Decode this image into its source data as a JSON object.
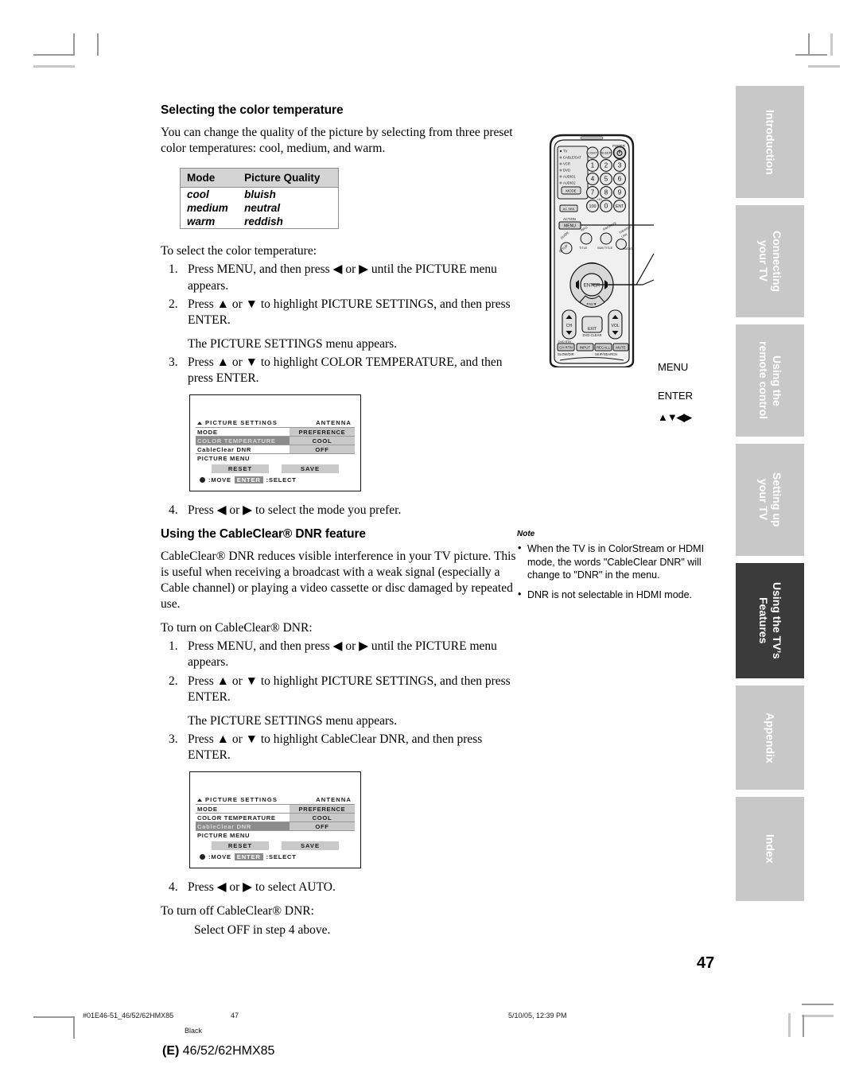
{
  "document": {
    "page_number": "47",
    "model_line_prefix": "(E)",
    "model_line": "46/52/62HMX85"
  },
  "section_color": {
    "tab_inactive": "#c8c8c8",
    "tab_active": "#3b3b3b",
    "table_header_bg": "#d4d4d4",
    "osd_highlight": "#8c8c8c",
    "osd_value_bg": "#c9c9c9"
  },
  "section1": {
    "title": "Selecting the color temperature",
    "intro": "You can change the quality of the picture by selecting from three preset color temperatures: cool, medium, and warm.",
    "table": {
      "headers": [
        "Mode",
        "Picture Quality"
      ],
      "rows": [
        [
          "cool",
          "bluish"
        ],
        [
          "medium",
          "neutral"
        ],
        [
          "warm",
          "reddish"
        ]
      ]
    },
    "lead_in": "To select the color temperature:",
    "steps": [
      {
        "num": "1.",
        "text": "Press MENU, and then press ◀ or ▶ until the PICTURE menu appears."
      },
      {
        "num": "2.",
        "text": "Press ▲ or ▼ to highlight PICTURE SETTINGS, and then press ENTER."
      },
      {
        "num": "3.",
        "text": "Press ▲ or ▼ to highlight COLOR TEMPERATURE, and then press ENTER."
      }
    ],
    "substep_after_2": "The PICTURE SETTINGS menu appears.",
    "step4": {
      "num": "4.",
      "text": "Press ◀ or ▶ to select the mode you prefer."
    }
  },
  "osd1": {
    "title": "PICTURE SETTINGS",
    "source": "ANTENNA",
    "rows": [
      {
        "label": "MODE",
        "value": "PREFERENCE",
        "selected": false
      },
      {
        "label": "COLOR TEMPERATURE",
        "value": "COOL",
        "selected": true
      },
      {
        "label": "CableClear DNR",
        "value": "OFF",
        "selected": false
      },
      {
        "label": "PICTURE MENU",
        "value": "",
        "selected": false
      }
    ],
    "buttons": [
      "RESET",
      "SAVE"
    ],
    "footer_move": ":MOVE",
    "footer_enter": "ENTER",
    "footer_select": ":SELECT"
  },
  "section2": {
    "title": "Using the CableClear® DNR feature",
    "intro": "CableClear® DNR reduces visible interference in your TV picture. This is useful when receiving a broadcast with a weak signal (especially a Cable channel) or playing a video cassette or disc damaged by repeated use.",
    "lead_in": "To turn on CableClear® DNR:",
    "steps": [
      {
        "num": "1.",
        "text": "Press MENU, and then press ◀ or ▶ until the PICTURE menu appears."
      },
      {
        "num": "2.",
        "text": "Press ▲ or ▼ to highlight PICTURE SETTINGS, and then press ENTER."
      },
      {
        "num": "3.",
        "text": "Press ▲ or ▼ to highlight CableClear DNR, and then press ENTER."
      }
    ],
    "substep_after_2": "The PICTURE SETTINGS menu appears.",
    "step4": {
      "num": "4.",
      "text": "Press ◀ or ▶ to select AUTO."
    },
    "turn_off_lead": "To turn off CableClear® DNR:",
    "turn_off_text": "Select OFF in step 4 above."
  },
  "osd2": {
    "title": "PICTURE SETTINGS",
    "source": "ANTENNA",
    "rows": [
      {
        "label": "MODE",
        "value": "PREFERENCE",
        "selected": false
      },
      {
        "label": "COLOR TEMPERATURE",
        "value": "COOL",
        "selected": false
      },
      {
        "label": "CableClear DNR",
        "value": "OFF",
        "selected": true
      },
      {
        "label": "PICTURE MENU",
        "value": "",
        "selected": false
      }
    ],
    "buttons": [
      "RESET",
      "SAVE"
    ],
    "footer_move": ":MOVE",
    "footer_enter": "ENTER",
    "footer_select": ":SELECT"
  },
  "note": {
    "heading": "Note",
    "items": [
      "When the TV is in ColorStream or HDMI mode, the words \"CableClear DNR\" will change to \"DNR\" in the menu.",
      "DNR is not selectable in HDMI mode."
    ]
  },
  "remote": {
    "device_labels": [
      "TV",
      "CABLE/SAT",
      "VCR",
      "DVD",
      "AUDIO1",
      "AUDIO2"
    ],
    "mode_button": "MODE",
    "power_label": "POWER",
    "light_button": "LIGHT",
    "sleep_button": "SLEEP",
    "ac_sbs_button": "AC SBS",
    "keypad": [
      "1",
      "2",
      "3",
      "4",
      "5",
      "6",
      "7",
      "8",
      "9",
      "100",
      "0",
      "ENT"
    ],
    "plus10_label": "+10",
    "action_label": "ACTION",
    "menu_button": "MENU",
    "guide_button": "GUIDE",
    "setup_label": "SETUP",
    "info_button": "INFO",
    "title_label": "TITLE",
    "favorite_button": "FAVORITE",
    "subtitle_label": "SUB TITLE",
    "theater_link_button": "THEATER LINK",
    "audio_label": "AUDIO",
    "fav_up": "FAV▲",
    "fav_down": "FAV▼",
    "enter_button": "ENTER",
    "ch_button": "CH",
    "vol_button": "VOL",
    "exit_button": "EXIT",
    "dvd_clear_label": "DVD CLEAR",
    "bottom_row": [
      "CH RTN",
      "INPUT",
      "RECALL",
      "MUTE"
    ],
    "dvd_rtn_label": "DVD RTN",
    "slow_dir_label": "SLOW/DIR",
    "skip_search_label": "SKIP/SEARCH",
    "callouts": [
      {
        "label": "MENU"
      },
      {
        "label": "ENTER"
      },
      {
        "label": "▲▼◀▶"
      }
    ]
  },
  "tabs": [
    {
      "label": "Introduction",
      "active": false
    },
    {
      "label": "Connecting\nyour TV",
      "active": false
    },
    {
      "label": "Using the\nremote control",
      "active": false
    },
    {
      "label": "Setting up\nyour TV",
      "active": false
    },
    {
      "label": "Using the TV's\nFeatures",
      "active": true
    },
    {
      "label": "Appendix",
      "active": false
    },
    {
      "label": "Index",
      "active": false
    }
  ],
  "footer": {
    "file": "#01E46-51_46/52/62HMX85",
    "page": "47",
    "date": "5/10/05, 12:39 PM",
    "black": "Black"
  }
}
